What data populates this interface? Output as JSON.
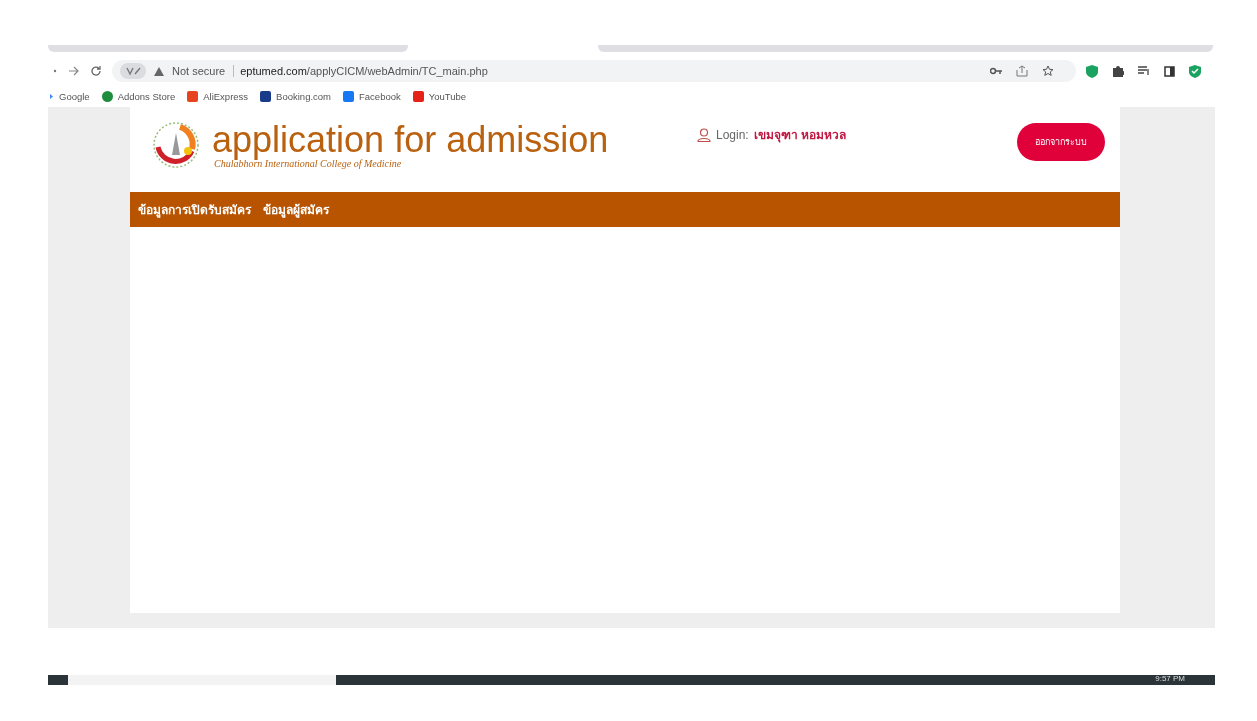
{
  "browser": {
    "security": "Not secure",
    "url_host": "eptumed.com",
    "url_path": "/applyCICM/webAdmin/TC_main.php",
    "bookmarks": [
      {
        "label": "Google",
        "color": "#4285f4"
      },
      {
        "label": "Addons Store",
        "color": "#1e8e3e"
      },
      {
        "label": "AliExpress",
        "color": "#e8431f"
      },
      {
        "label": "Booking.com",
        "color": "#1a3a8a"
      },
      {
        "label": "Facebook",
        "color": "#1877f2"
      },
      {
        "label": "YouTube",
        "color": "#e62117"
      }
    ]
  },
  "header": {
    "title": "application for admission",
    "subtitle": "Chulabhorn International College of Medicine",
    "login_label": "Login:",
    "user_name": "เขมจุฑา หอมหวล",
    "logout_button": "ออกจากระบบ"
  },
  "nav": [
    {
      "label": "ข้อมูลการเปิดรับสมัคร"
    },
    {
      "label": "ข้อมูลผู้สมัคร"
    }
  ],
  "taskbar": {
    "time": "9:57 PM"
  }
}
